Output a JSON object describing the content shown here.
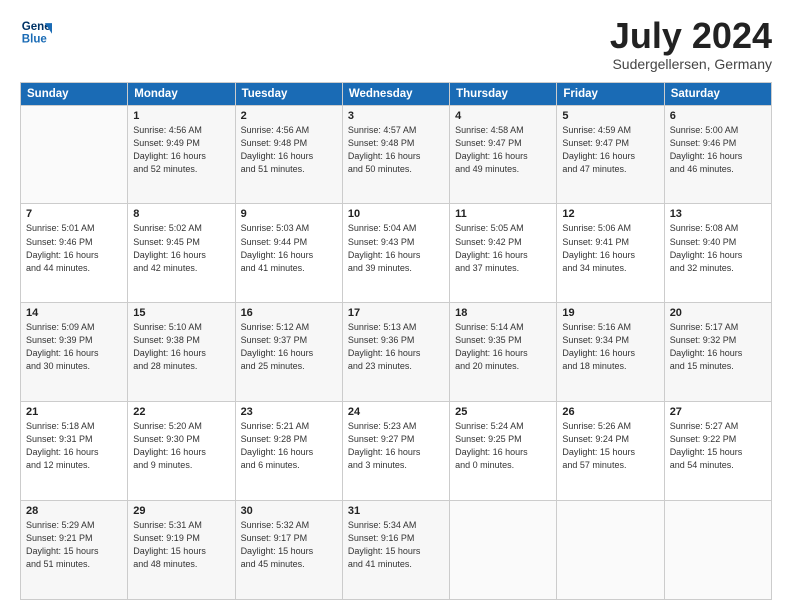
{
  "header": {
    "logo_line1": "General",
    "logo_line2": "Blue",
    "title": "July 2024",
    "location": "Sudergellersen, Germany"
  },
  "days_of_week": [
    "Sunday",
    "Monday",
    "Tuesday",
    "Wednesday",
    "Thursday",
    "Friday",
    "Saturday"
  ],
  "weeks": [
    [
      {
        "num": "",
        "detail": ""
      },
      {
        "num": "1",
        "detail": "Sunrise: 4:56 AM\nSunset: 9:49 PM\nDaylight: 16 hours\nand 52 minutes."
      },
      {
        "num": "2",
        "detail": "Sunrise: 4:56 AM\nSunset: 9:48 PM\nDaylight: 16 hours\nand 51 minutes."
      },
      {
        "num": "3",
        "detail": "Sunrise: 4:57 AM\nSunset: 9:48 PM\nDaylight: 16 hours\nand 50 minutes."
      },
      {
        "num": "4",
        "detail": "Sunrise: 4:58 AM\nSunset: 9:47 PM\nDaylight: 16 hours\nand 49 minutes."
      },
      {
        "num": "5",
        "detail": "Sunrise: 4:59 AM\nSunset: 9:47 PM\nDaylight: 16 hours\nand 47 minutes."
      },
      {
        "num": "6",
        "detail": "Sunrise: 5:00 AM\nSunset: 9:46 PM\nDaylight: 16 hours\nand 46 minutes."
      }
    ],
    [
      {
        "num": "7",
        "detail": "Sunrise: 5:01 AM\nSunset: 9:46 PM\nDaylight: 16 hours\nand 44 minutes."
      },
      {
        "num": "8",
        "detail": "Sunrise: 5:02 AM\nSunset: 9:45 PM\nDaylight: 16 hours\nand 42 minutes."
      },
      {
        "num": "9",
        "detail": "Sunrise: 5:03 AM\nSunset: 9:44 PM\nDaylight: 16 hours\nand 41 minutes."
      },
      {
        "num": "10",
        "detail": "Sunrise: 5:04 AM\nSunset: 9:43 PM\nDaylight: 16 hours\nand 39 minutes."
      },
      {
        "num": "11",
        "detail": "Sunrise: 5:05 AM\nSunset: 9:42 PM\nDaylight: 16 hours\nand 37 minutes."
      },
      {
        "num": "12",
        "detail": "Sunrise: 5:06 AM\nSunset: 9:41 PM\nDaylight: 16 hours\nand 34 minutes."
      },
      {
        "num": "13",
        "detail": "Sunrise: 5:08 AM\nSunset: 9:40 PM\nDaylight: 16 hours\nand 32 minutes."
      }
    ],
    [
      {
        "num": "14",
        "detail": "Sunrise: 5:09 AM\nSunset: 9:39 PM\nDaylight: 16 hours\nand 30 minutes."
      },
      {
        "num": "15",
        "detail": "Sunrise: 5:10 AM\nSunset: 9:38 PM\nDaylight: 16 hours\nand 28 minutes."
      },
      {
        "num": "16",
        "detail": "Sunrise: 5:12 AM\nSunset: 9:37 PM\nDaylight: 16 hours\nand 25 minutes."
      },
      {
        "num": "17",
        "detail": "Sunrise: 5:13 AM\nSunset: 9:36 PM\nDaylight: 16 hours\nand 23 minutes."
      },
      {
        "num": "18",
        "detail": "Sunrise: 5:14 AM\nSunset: 9:35 PM\nDaylight: 16 hours\nand 20 minutes."
      },
      {
        "num": "19",
        "detail": "Sunrise: 5:16 AM\nSunset: 9:34 PM\nDaylight: 16 hours\nand 18 minutes."
      },
      {
        "num": "20",
        "detail": "Sunrise: 5:17 AM\nSunset: 9:32 PM\nDaylight: 16 hours\nand 15 minutes."
      }
    ],
    [
      {
        "num": "21",
        "detail": "Sunrise: 5:18 AM\nSunset: 9:31 PM\nDaylight: 16 hours\nand 12 minutes."
      },
      {
        "num": "22",
        "detail": "Sunrise: 5:20 AM\nSunset: 9:30 PM\nDaylight: 16 hours\nand 9 minutes."
      },
      {
        "num": "23",
        "detail": "Sunrise: 5:21 AM\nSunset: 9:28 PM\nDaylight: 16 hours\nand 6 minutes."
      },
      {
        "num": "24",
        "detail": "Sunrise: 5:23 AM\nSunset: 9:27 PM\nDaylight: 16 hours\nand 3 minutes."
      },
      {
        "num": "25",
        "detail": "Sunrise: 5:24 AM\nSunset: 9:25 PM\nDaylight: 16 hours\nand 0 minutes."
      },
      {
        "num": "26",
        "detail": "Sunrise: 5:26 AM\nSunset: 9:24 PM\nDaylight: 15 hours\nand 57 minutes."
      },
      {
        "num": "27",
        "detail": "Sunrise: 5:27 AM\nSunset: 9:22 PM\nDaylight: 15 hours\nand 54 minutes."
      }
    ],
    [
      {
        "num": "28",
        "detail": "Sunrise: 5:29 AM\nSunset: 9:21 PM\nDaylight: 15 hours\nand 51 minutes."
      },
      {
        "num": "29",
        "detail": "Sunrise: 5:31 AM\nSunset: 9:19 PM\nDaylight: 15 hours\nand 48 minutes."
      },
      {
        "num": "30",
        "detail": "Sunrise: 5:32 AM\nSunset: 9:17 PM\nDaylight: 15 hours\nand 45 minutes."
      },
      {
        "num": "31",
        "detail": "Sunrise: 5:34 AM\nSunset: 9:16 PM\nDaylight: 15 hours\nand 41 minutes."
      },
      {
        "num": "",
        "detail": ""
      },
      {
        "num": "",
        "detail": ""
      },
      {
        "num": "",
        "detail": ""
      }
    ]
  ]
}
